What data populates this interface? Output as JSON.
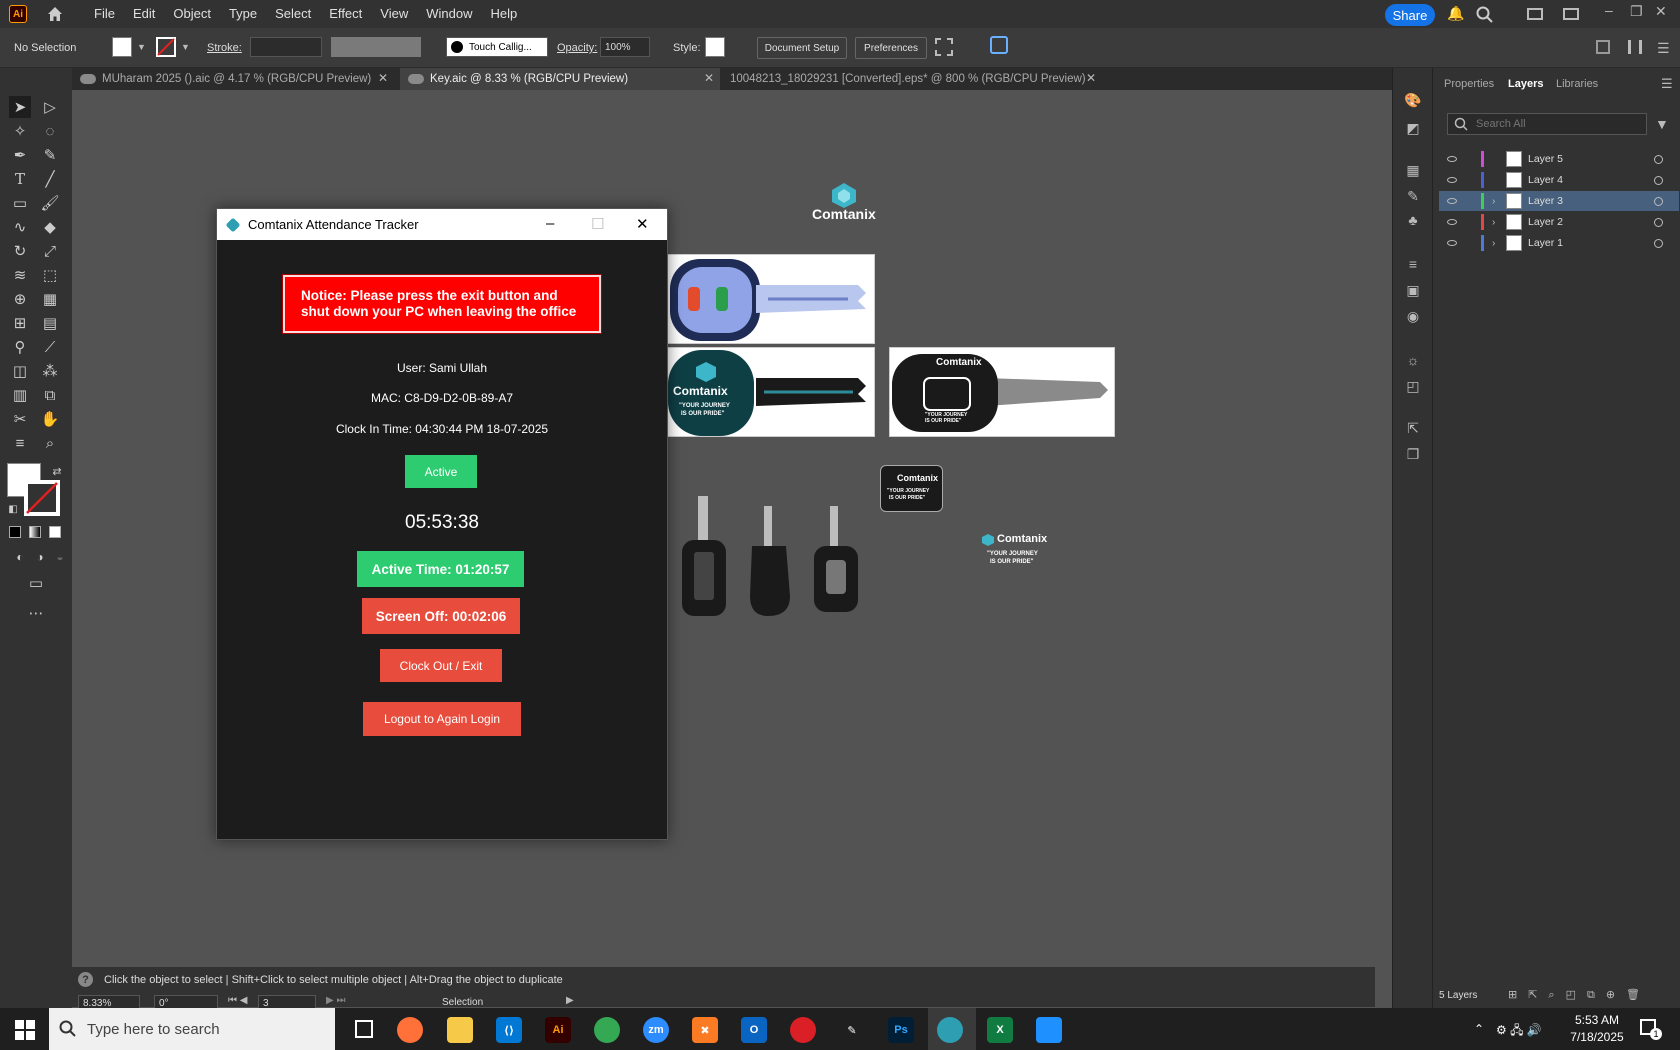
{
  "app": {
    "logo": "Ai",
    "menu": [
      "File",
      "Edit",
      "Object",
      "Type",
      "Select",
      "Effect",
      "View",
      "Window",
      "Help"
    ],
    "share_label": "Share"
  },
  "controlbar": {
    "selection": "No Selection",
    "stroke_label": "Stroke:",
    "brush": "Touch Callig...",
    "opacity_label": "Opacity:",
    "opacity_value": "100%",
    "style_label": "Style:",
    "document_setup": "Document Setup",
    "preferences": "Preferences"
  },
  "tabs": [
    {
      "label": "MUharam 2025 ().aic @ 4.17 % (RGB/CPU Preview)",
      "active": false
    },
    {
      "label": "Key.aic @ 8.33 % (RGB/CPU Preview)",
      "active": true
    },
    {
      "label": "10048213_18029231 [Converted].eps* @ 800 % (RGB/CPU Preview)",
      "active": false
    }
  ],
  "panel": {
    "tabs": [
      "Properties",
      "Layers",
      "Libraries"
    ],
    "search_placeholder": "Search All",
    "layers": [
      {
        "name": "Layer 5",
        "color": "#d24bd7",
        "selected": false,
        "expandable": false
      },
      {
        "name": "Layer 4",
        "color": "#4b5fd7",
        "selected": false,
        "expandable": false
      },
      {
        "name": "Layer 3",
        "color": "#3ecf5a",
        "selected": true,
        "expandable": true
      },
      {
        "name": "Layer 2",
        "color": "#e04848",
        "selected": false,
        "expandable": true
      },
      {
        "name": "Layer 1",
        "color": "#4b7bd7",
        "selected": false,
        "expandable": true
      }
    ],
    "layers_count": "5 Layers"
  },
  "status": {
    "hint": "Click the object to select  |  Shift+Click to select multiple object  |  Alt+Drag the object to duplicate",
    "zoom": "8.33%",
    "rotation": "0°",
    "artboard": "3",
    "tool": "Selection"
  },
  "artwork": {
    "brand": "Comtanix",
    "slogan_line1": "\"YOUR JOURNEY",
    "slogan_line2": "IS OUR PRIDE\""
  },
  "tracker": {
    "title": "Comtanix Attendance Tracker",
    "notice": "Notice: Please press the exit button and shut down your PC when leaving the office",
    "user": "User: Sami Ullah",
    "mac": "MAC: C8-D9-D2-0B-89-A7",
    "clock_in": "Clock In Time: 04:30:44 PM 18-07-2025",
    "status": "Active",
    "timer": "05:53:38",
    "active_time": "Active Time: 01:20:57",
    "screen_off": "Screen Off: 00:02:06",
    "clock_out": "Clock Out / Exit",
    "logout": "Logout to Again Login"
  },
  "taskbar": {
    "search_placeholder": "Type here to search",
    "time": "5:53 AM",
    "date": "7/18/2025",
    "apps": [
      "firefox",
      "file-explorer",
      "vscode",
      "illustrator",
      "chrome",
      "zoom",
      "xampp",
      "outlook",
      "creative-cloud",
      "brush",
      "photoshop",
      "comtanix",
      "excel",
      "photos"
    ],
    "notification_count": "1"
  },
  "colors": {
    "accent": "#1473e6",
    "active_green": "#2ecc71",
    "danger_red": "#e74c3c",
    "notice_red": "#ff0000"
  }
}
